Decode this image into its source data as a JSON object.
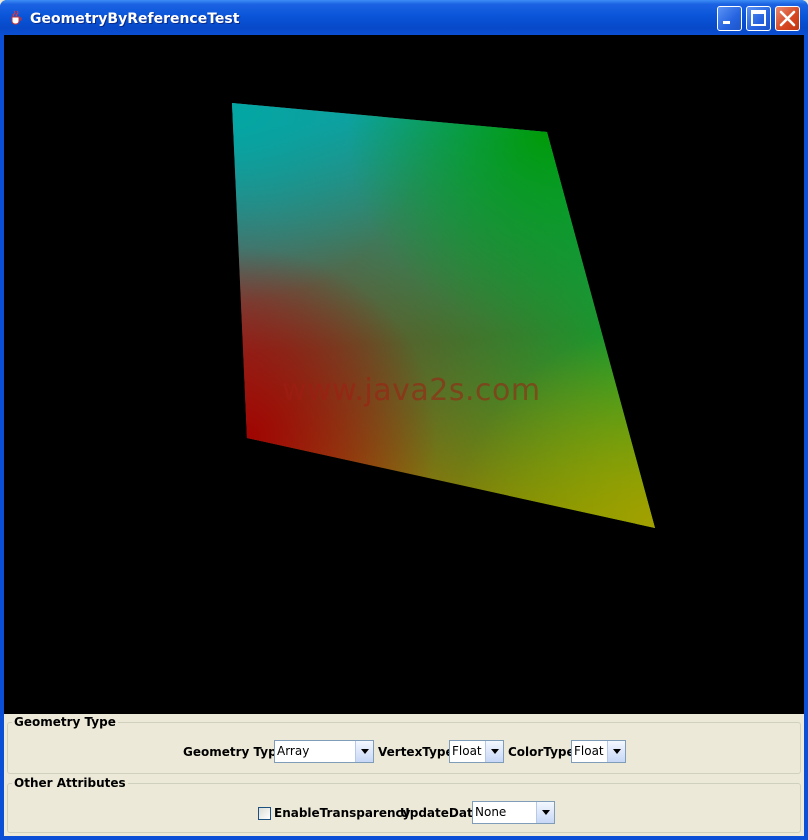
{
  "window": {
    "title": "GeometryByReferenceTest",
    "app_icon": "java-cup-icon"
  },
  "title_buttons": {
    "minimize": "minimize-icon",
    "maximize": "maximize-icon",
    "close": "close-icon"
  },
  "canvas": {
    "watermark": "www.java2s.com",
    "shape_colors": {
      "top_left": "#00a8a0",
      "top_right": "#009a00",
      "bottom_right": "#a0a000",
      "bottom_left": "#a00000"
    }
  },
  "geometry_type_group": {
    "legend": "Geometry Type",
    "geometry_label": "Geometry Type",
    "geometry_value": "Array",
    "vertex_label": "VertexType",
    "vertex_value": "Float",
    "color_label": "ColorType",
    "color_value": "Float"
  },
  "other_attributes_group": {
    "legend": "Other Attributes",
    "transparency_label": "EnableTransparency",
    "transparency_checked": false,
    "update_label": "UpdateData",
    "update_value": "None"
  }
}
